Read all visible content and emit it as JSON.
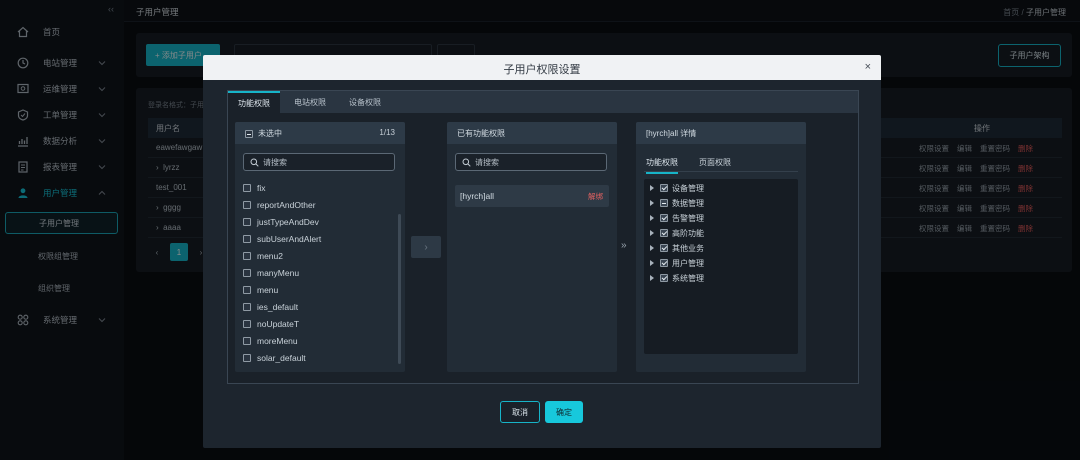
{
  "app": {
    "collapse_icon": "‹‹",
    "page_title": "子用户管理",
    "breadcrumb": {
      "home": "首页",
      "sep": "/",
      "current": "子用户管理"
    }
  },
  "sidebar": {
    "items": [
      {
        "label": "首页",
        "icon": "home-icon"
      },
      {
        "label": "电站管理",
        "icon": "power-station-icon"
      },
      {
        "label": "运维管理",
        "icon": "maintenance-icon"
      },
      {
        "label": "工单管理",
        "icon": "work-order-icon"
      },
      {
        "label": "数据分析",
        "icon": "analytics-icon"
      },
      {
        "label": "报表管理",
        "icon": "report-icon"
      },
      {
        "label": "用户管理",
        "icon": "user-icon"
      },
      {
        "label": "系统管理",
        "icon": "system-icon"
      }
    ],
    "sub_items": [
      "子用户管理",
      "权限组管理",
      "组织管理"
    ]
  },
  "background": {
    "add_button": "+ 添加子用户",
    "org_button": "子用户架构",
    "hint": "登录名格式：子用",
    "table_headers": {
      "name": "用户名",
      "ops": "操作"
    },
    "rows": [
      {
        "name": "eawefawgaw"
      },
      {
        "name": "lyrzz"
      },
      {
        "name": "test_001"
      },
      {
        "name": "gggg"
      },
      {
        "name": "aaaa"
      }
    ],
    "ops": {
      "perm": "权限设置",
      "edit": "编辑",
      "reset": "重置密码",
      "delete": "删除"
    },
    "pager": {
      "prev": "‹",
      "current": "1",
      "next": "›"
    }
  },
  "modal": {
    "title": "子用户权限设置",
    "close": "×",
    "tabs": [
      "功能权限",
      "电站权限",
      "设备权限"
    ],
    "left_panel": {
      "title": "未选中",
      "count": "1/13",
      "search_placeholder": "请搜索",
      "items": [
        "fix",
        "reportAndOther",
        "justTypeAndDev",
        "subUserAndAlert",
        "menu2",
        "manyMenu",
        "menu",
        "ies_default",
        "noUpdateT",
        "moreMenu",
        "solar_default"
      ]
    },
    "transfer_arrow": "›",
    "middle_panel": {
      "title": "已有功能权限",
      "search_placeholder": "请搜索",
      "selected": {
        "name": "[hyrch]all",
        "unbind": "解绑"
      }
    },
    "detail_arrow": "»",
    "right_panel": {
      "title": "[hyrch]all 详情",
      "tabs": [
        "功能权限",
        "页面权限"
      ],
      "tree": [
        {
          "label": "设备管理",
          "state": "checked"
        },
        {
          "label": "数据管理",
          "state": "partial"
        },
        {
          "label": "告警管理",
          "state": "checked"
        },
        {
          "label": "高阶功能",
          "state": "checked"
        },
        {
          "label": "其他业务",
          "state": "checked"
        },
        {
          "label": "用户管理",
          "state": "checked"
        },
        {
          "label": "系统管理",
          "state": "checked"
        }
      ]
    },
    "cancel": "取消",
    "ok": "确定"
  }
}
